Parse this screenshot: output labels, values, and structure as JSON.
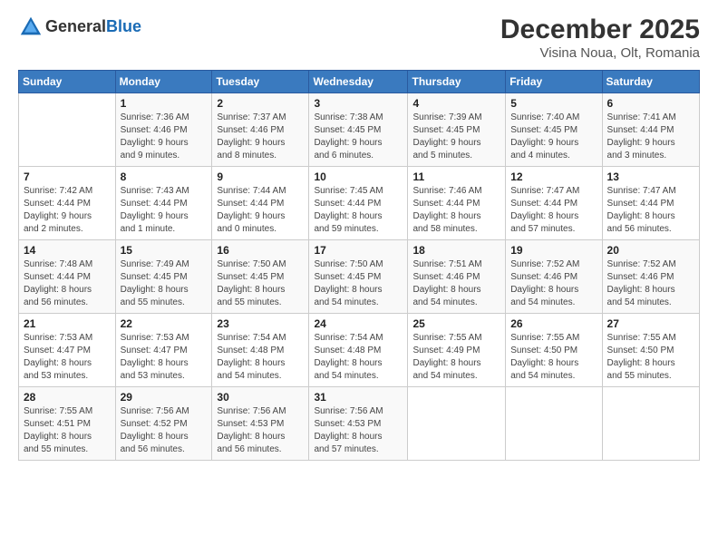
{
  "logo": {
    "general": "General",
    "blue": "Blue"
  },
  "title": "December 2025",
  "location": "Visina Noua, Olt, Romania",
  "header_days": [
    "Sunday",
    "Monday",
    "Tuesday",
    "Wednesday",
    "Thursday",
    "Friday",
    "Saturday"
  ],
  "weeks": [
    [
      {
        "day": "",
        "info": ""
      },
      {
        "day": "1",
        "info": "Sunrise: 7:36 AM\nSunset: 4:46 PM\nDaylight: 9 hours\nand 9 minutes."
      },
      {
        "day": "2",
        "info": "Sunrise: 7:37 AM\nSunset: 4:46 PM\nDaylight: 9 hours\nand 8 minutes."
      },
      {
        "day": "3",
        "info": "Sunrise: 7:38 AM\nSunset: 4:45 PM\nDaylight: 9 hours\nand 6 minutes."
      },
      {
        "day": "4",
        "info": "Sunrise: 7:39 AM\nSunset: 4:45 PM\nDaylight: 9 hours\nand 5 minutes."
      },
      {
        "day": "5",
        "info": "Sunrise: 7:40 AM\nSunset: 4:45 PM\nDaylight: 9 hours\nand 4 minutes."
      },
      {
        "day": "6",
        "info": "Sunrise: 7:41 AM\nSunset: 4:44 PM\nDaylight: 9 hours\nand 3 minutes."
      }
    ],
    [
      {
        "day": "7",
        "info": "Sunrise: 7:42 AM\nSunset: 4:44 PM\nDaylight: 9 hours\nand 2 minutes."
      },
      {
        "day": "8",
        "info": "Sunrise: 7:43 AM\nSunset: 4:44 PM\nDaylight: 9 hours\nand 1 minute."
      },
      {
        "day": "9",
        "info": "Sunrise: 7:44 AM\nSunset: 4:44 PM\nDaylight: 9 hours\nand 0 minutes."
      },
      {
        "day": "10",
        "info": "Sunrise: 7:45 AM\nSunset: 4:44 PM\nDaylight: 8 hours\nand 59 minutes."
      },
      {
        "day": "11",
        "info": "Sunrise: 7:46 AM\nSunset: 4:44 PM\nDaylight: 8 hours\nand 58 minutes."
      },
      {
        "day": "12",
        "info": "Sunrise: 7:47 AM\nSunset: 4:44 PM\nDaylight: 8 hours\nand 57 minutes."
      },
      {
        "day": "13",
        "info": "Sunrise: 7:47 AM\nSunset: 4:44 PM\nDaylight: 8 hours\nand 56 minutes."
      }
    ],
    [
      {
        "day": "14",
        "info": "Sunrise: 7:48 AM\nSunset: 4:44 PM\nDaylight: 8 hours\nand 56 minutes."
      },
      {
        "day": "15",
        "info": "Sunrise: 7:49 AM\nSunset: 4:45 PM\nDaylight: 8 hours\nand 55 minutes."
      },
      {
        "day": "16",
        "info": "Sunrise: 7:50 AM\nSunset: 4:45 PM\nDaylight: 8 hours\nand 55 minutes."
      },
      {
        "day": "17",
        "info": "Sunrise: 7:50 AM\nSunset: 4:45 PM\nDaylight: 8 hours\nand 54 minutes."
      },
      {
        "day": "18",
        "info": "Sunrise: 7:51 AM\nSunset: 4:46 PM\nDaylight: 8 hours\nand 54 minutes."
      },
      {
        "day": "19",
        "info": "Sunrise: 7:52 AM\nSunset: 4:46 PM\nDaylight: 8 hours\nand 54 minutes."
      },
      {
        "day": "20",
        "info": "Sunrise: 7:52 AM\nSunset: 4:46 PM\nDaylight: 8 hours\nand 54 minutes."
      }
    ],
    [
      {
        "day": "21",
        "info": "Sunrise: 7:53 AM\nSunset: 4:47 PM\nDaylight: 8 hours\nand 53 minutes."
      },
      {
        "day": "22",
        "info": "Sunrise: 7:53 AM\nSunset: 4:47 PM\nDaylight: 8 hours\nand 53 minutes."
      },
      {
        "day": "23",
        "info": "Sunrise: 7:54 AM\nSunset: 4:48 PM\nDaylight: 8 hours\nand 54 minutes."
      },
      {
        "day": "24",
        "info": "Sunrise: 7:54 AM\nSunset: 4:48 PM\nDaylight: 8 hours\nand 54 minutes."
      },
      {
        "day": "25",
        "info": "Sunrise: 7:55 AM\nSunset: 4:49 PM\nDaylight: 8 hours\nand 54 minutes."
      },
      {
        "day": "26",
        "info": "Sunrise: 7:55 AM\nSunset: 4:50 PM\nDaylight: 8 hours\nand 54 minutes."
      },
      {
        "day": "27",
        "info": "Sunrise: 7:55 AM\nSunset: 4:50 PM\nDaylight: 8 hours\nand 55 minutes."
      }
    ],
    [
      {
        "day": "28",
        "info": "Sunrise: 7:55 AM\nSunset: 4:51 PM\nDaylight: 8 hours\nand 55 minutes."
      },
      {
        "day": "29",
        "info": "Sunrise: 7:56 AM\nSunset: 4:52 PM\nDaylight: 8 hours\nand 56 minutes."
      },
      {
        "day": "30",
        "info": "Sunrise: 7:56 AM\nSunset: 4:53 PM\nDaylight: 8 hours\nand 56 minutes."
      },
      {
        "day": "31",
        "info": "Sunrise: 7:56 AM\nSunset: 4:53 PM\nDaylight: 8 hours\nand 57 minutes."
      },
      {
        "day": "",
        "info": ""
      },
      {
        "day": "",
        "info": ""
      },
      {
        "day": "",
        "info": ""
      }
    ]
  ]
}
